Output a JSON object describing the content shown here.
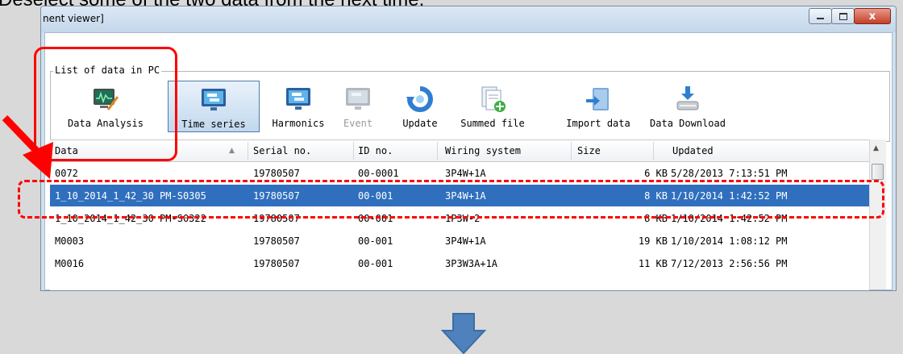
{
  "slide": {
    "caption_partial": "Deselect some of the two data from the next time."
  },
  "window": {
    "title": "nent viewer]",
    "close_glyph": "x"
  },
  "group": {
    "label": "List of data in PC"
  },
  "toolbar": [
    {
      "label": "Data Analysis",
      "icon": "data-analysis-icon",
      "state": "normal"
    },
    {
      "label": "Time series",
      "icon": "monitor-icon",
      "state": "active"
    },
    {
      "label": "Harmonics",
      "icon": "monitor-icon",
      "state": "normal"
    },
    {
      "label": "Event",
      "icon": "monitor-icon",
      "state": "disabled"
    },
    {
      "label": "Update",
      "icon": "refresh-icon",
      "state": "normal"
    },
    {
      "label": "Summed file",
      "icon": "add-file-icon",
      "state": "normal"
    },
    {
      "label": "Import data",
      "icon": "import-icon",
      "state": "normal"
    },
    {
      "label": "Data Download",
      "icon": "download-icon",
      "state": "normal"
    }
  ],
  "table": {
    "columns": [
      "Data",
      "Serial no.",
      "ID no.",
      "Wiring system",
      "Size",
      "Updated"
    ],
    "sort_indicator": "▲",
    "rows": [
      {
        "data": "0072",
        "serial": "19780507",
        "id": "00-0001",
        "wiring": "3P4W+1A",
        "size": "6 KB",
        "updated": "5/28/2013 7:13:51 PM",
        "selected": false
      },
      {
        "data": "1_10_2014_1_42_30 PM-S0305",
        "serial": "19780507",
        "id": "00-001",
        "wiring": "3P4W+1A",
        "size": "8 KB",
        "updated": "1/10/2014 1:42:52 PM",
        "selected": true
      },
      {
        "data": "1_10_2014_1_42_30 PM-S0322",
        "serial": "19780507",
        "id": "00-001",
        "wiring": "1P3W-2",
        "size": "8 KB",
        "updated": "1/10/2014 1:42:52 PM",
        "selected": false
      },
      {
        "data": "M0003",
        "serial": "19780507",
        "id": "00-001",
        "wiring": "3P4W+1A",
        "size": "19 KB",
        "updated": "1/10/2014 1:08:12 PM",
        "selected": false
      },
      {
        "data": "M0016",
        "serial": "19780507",
        "id": "00-001",
        "wiring": "3P3W3A+1A",
        "size": "11 KB",
        "updated": "7/12/2013 2:56:56 PM",
        "selected": false
      }
    ]
  },
  "colors": {
    "highlight": "#ff0000",
    "selection": "#2f6fbe",
    "arrow_blue": "#4f81bd"
  }
}
